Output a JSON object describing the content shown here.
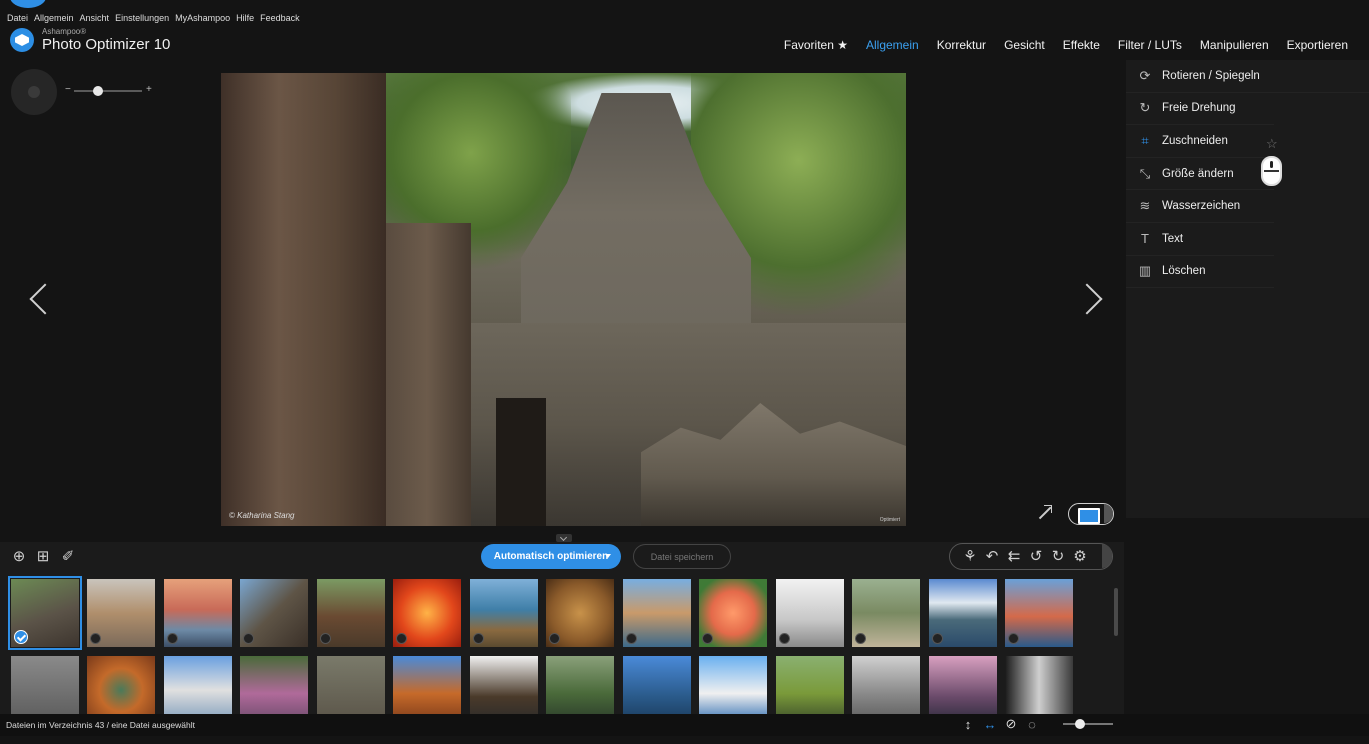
{
  "menu": [
    "Datei",
    "Allgemein",
    "Ansicht",
    "Einstellungen",
    "MyAshampoo",
    "Hilfe",
    "Feedback"
  ],
  "app": {
    "brand": "Ashampoo®",
    "product": "Photo Optimizer 10",
    "icon": "ashampoo-logo-icon"
  },
  "topnav": {
    "items": [
      "Favoriten ★",
      "Allgemein",
      "Korrektur",
      "Gesicht",
      "Effekte",
      "Filter / LUTs",
      "Manipulieren",
      "Exportieren"
    ],
    "active": "Allgemein",
    "accent": "#3ba0f0"
  },
  "sidepanel": {
    "items": [
      {
        "label": "Rotieren / Spiegeln",
        "icon": "rotate-flip-icon"
      },
      {
        "label": "Freie Drehung",
        "icon": "free-rotate-icon"
      },
      {
        "label": "Zuschneiden",
        "icon": "crop-icon"
      },
      {
        "label": "Größe ändern",
        "icon": "resize-icon"
      },
      {
        "label": "Wasserzeichen",
        "icon": "watermark-icon"
      },
      {
        "label": "Text",
        "icon": "text-icon"
      },
      {
        "label": "Löschen",
        "icon": "delete-icon"
      }
    ]
  },
  "image": {
    "credit": "© Katharina Stang",
    "badge": "Optimiert"
  },
  "toolbar": {
    "auto_optimize": "Automatisch optimieren",
    "save_file": "Datei speichern",
    "accent": "#2f8fe6"
  },
  "thumbnails": {
    "row1": [
      "temple",
      "cat",
      "sunset-beach",
      "tree-heart",
      "horses",
      "red-flower",
      "coast-cliff",
      "nuts",
      "cinque-terre",
      "orange-flowers",
      "foggy-bridge",
      "frog",
      "mountain-lake",
      "harbor-houses"
    ],
    "row2": [
      "route-66",
      "horseshoe-bend",
      "beach-huts",
      "woman-flowers",
      "monkeys",
      "monument-valley",
      "horse-carriage",
      "park-pond",
      "lake-boats",
      "santorini",
      "old-car",
      "colonial-building",
      "palm-sunset",
      "bw-doorway"
    ],
    "selected_index": 0
  },
  "status": {
    "text": "Dateien im Verzeichnis 43 / eine Datei ausgewählt"
  }
}
